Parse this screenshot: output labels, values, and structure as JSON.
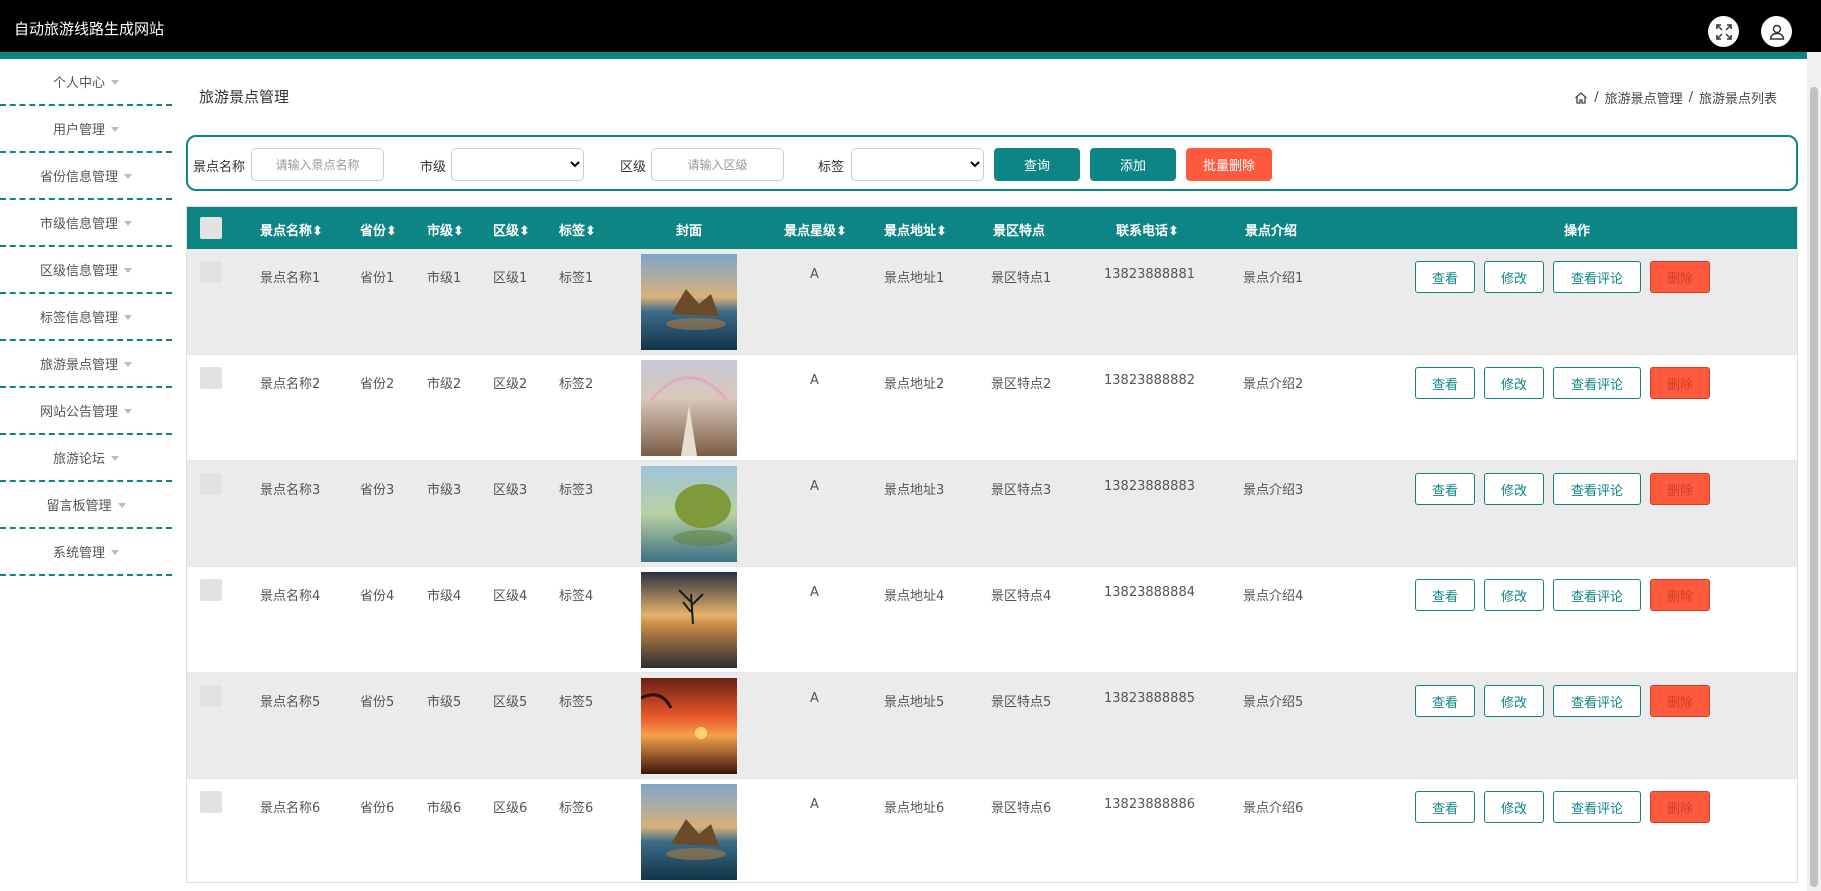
{
  "app": {
    "title": "自动旅游线路生成网站"
  },
  "sidebar": {
    "items": [
      {
        "label": "个人中心"
      },
      {
        "label": "用户管理"
      },
      {
        "label": "省份信息管理"
      },
      {
        "label": "市级信息管理"
      },
      {
        "label": "区级信息管理"
      },
      {
        "label": "标签信息管理"
      },
      {
        "label": "旅游景点管理"
      },
      {
        "label": "网站公告管理"
      },
      {
        "label": "旅游论坛"
      },
      {
        "label": "留言板管理"
      },
      {
        "label": "系统管理"
      }
    ]
  },
  "page": {
    "title": "旅游景点管理"
  },
  "breadcrumb": {
    "items": [
      "旅游景点管理",
      "旅游景点列表"
    ],
    "separator": "/"
  },
  "search": {
    "name_label": "景点名称",
    "name_placeholder": "请输入景点名称",
    "city_label": "市级",
    "district_label": "区级",
    "district_placeholder": "请输入区级",
    "tag_label": "标签",
    "query_button": "查询",
    "add_button": "添加",
    "batch_delete_button": "批量删除"
  },
  "table": {
    "headers": {
      "name": "景点名称",
      "province": "省份",
      "city": "市级",
      "district": "区级",
      "tag": "标签",
      "cover": "封面",
      "star": "景点星级",
      "address": "景点地址",
      "feature": "景区特点",
      "phone": "联系电话",
      "intro": "景点介绍",
      "actions": "操作"
    },
    "sortable_marker": "⬍",
    "rows": [
      {
        "name": "景点名称1",
        "province": "省份1",
        "city": "市级1",
        "district": "区级1",
        "tag": "标签1",
        "star": "A",
        "address": "景点地址1",
        "feature": "景区特点1",
        "phone": "13823888881",
        "intro": "景点介绍1"
      },
      {
        "name": "景点名称2",
        "province": "省份2",
        "city": "市级2",
        "district": "区级2",
        "tag": "标签2",
        "star": "A",
        "address": "景点地址2",
        "feature": "景区特点2",
        "phone": "13823888882",
        "intro": "景点介绍2"
      },
      {
        "name": "景点名称3",
        "province": "省份3",
        "city": "市级3",
        "district": "区级3",
        "tag": "标签3",
        "star": "A",
        "address": "景点地址3",
        "feature": "景区特点3",
        "phone": "13823888883",
        "intro": "景点介绍3"
      },
      {
        "name": "景点名称4",
        "province": "省份4",
        "city": "市级4",
        "district": "区级4",
        "tag": "标签4",
        "star": "A",
        "address": "景点地址4",
        "feature": "景区特点4",
        "phone": "13823888884",
        "intro": "景点介绍4"
      },
      {
        "name": "景点名称5",
        "province": "省份5",
        "city": "市级5",
        "district": "区级5",
        "tag": "标签5",
        "star": "A",
        "address": "景点地址5",
        "feature": "景区特点5",
        "phone": "13823888885",
        "intro": "景点介绍5"
      },
      {
        "name": "景点名称6",
        "province": "省份6",
        "city": "市级6",
        "district": "区级6",
        "tag": "标签6",
        "star": "A",
        "address": "景点地址6",
        "feature": "景区特点6",
        "phone": "13823888886",
        "intro": "景点介绍6"
      }
    ],
    "actions": {
      "view": "查看",
      "edit": "修改",
      "view_comments": "查看评论",
      "delete": "删除"
    }
  },
  "colors": {
    "accent": "#0e8585",
    "danger": "#ff5a3d",
    "topbar": "#000000"
  },
  "icons": {
    "fullscreen": "expand-icon",
    "user": "user-icon",
    "home": "home-icon"
  }
}
